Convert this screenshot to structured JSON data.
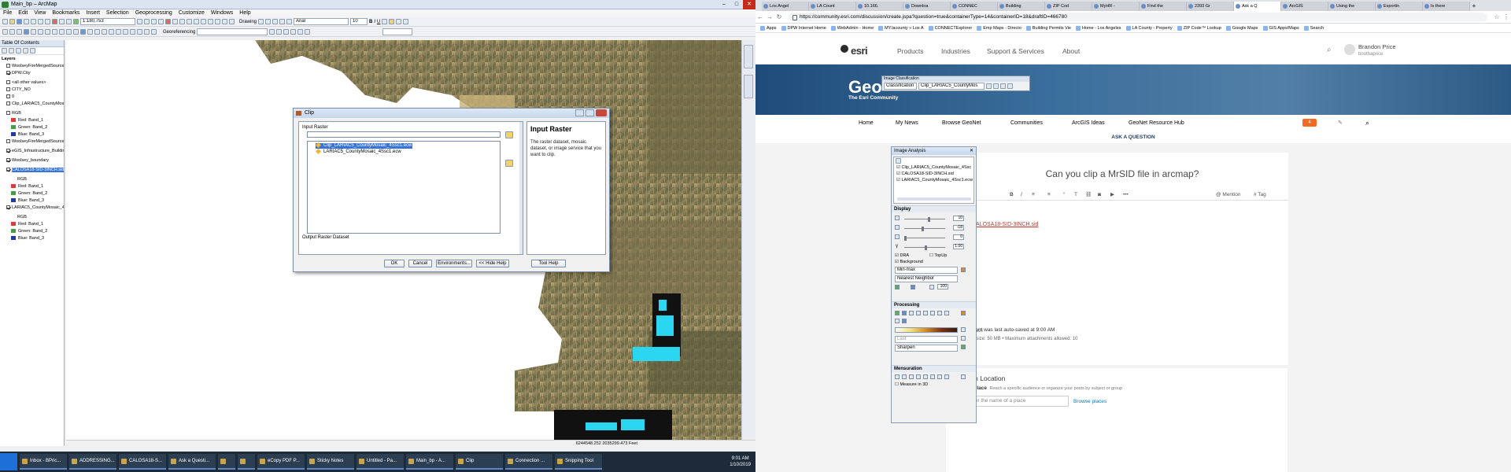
{
  "arcmap": {
    "title": "Main_bp – ArcMap",
    "menu": [
      "File",
      "Edit",
      "View",
      "Bookmarks",
      "Insert",
      "Selection",
      "Geoprocessing",
      "Customize",
      "Windows",
      "Help"
    ],
    "scale": "1:180,753",
    "drawing_label": "Drawing",
    "font_name": "Arial",
    "font_size": "10",
    "georef_label": "Georeferencing",
    "toc_title": "Table Of Contents",
    "toc": {
      "layers_label": "Layers",
      "items": [
        {
          "label": "WoolseyFireMergedSources_h",
          "checked": false,
          "indent": 0
        },
        {
          "label": "DPW.City",
          "checked": true,
          "indent": 0
        },
        {
          "label": "<all other values>",
          "checked": false,
          "indent": 2
        },
        {
          "label": "CITY_NO",
          "checked": false,
          "indent": 2
        },
        {
          "label": "0",
          "checked": false,
          "indent": 2
        },
        {
          "label": "Clip_LARIAC5_CountyMosaic_",
          "checked": false,
          "indent": 0
        },
        {
          "label": "RGB",
          "checked": false,
          "indent": 2
        },
        {
          "label": "Red:   Band_1",
          "swatch": "#e53935",
          "indent": 1
        },
        {
          "label": "Green: Band_2",
          "swatch": "#43a047",
          "indent": 1
        },
        {
          "label": "Blue:  Band_3",
          "swatch": "#1e3aa8",
          "indent": 1
        },
        {
          "label": "WoolseyFireMergedSources_h",
          "checked": false,
          "indent": 0
        },
        {
          "label": "eGIS_Infrastructure_Building_F",
          "checked": true,
          "indent": 0
        },
        {
          "label": "Woolsey_boundary",
          "checked": true,
          "indent": 0
        },
        {
          "label": "CALOSA18-SID-3INCH.sid",
          "checked": true,
          "indent": 0,
          "selected": true
        },
        {
          "label": "RGB",
          "indent": 2
        },
        {
          "label": "Red:   Band_1",
          "swatch": "#e53935",
          "indent": 1
        },
        {
          "label": "Green: Band_2",
          "swatch": "#43a047",
          "indent": 1
        },
        {
          "label": "Blue:  Band_3",
          "swatch": "#1e3aa8",
          "indent": 1
        },
        {
          "label": "LARIAC5_CountyMosaic_4Ssc",
          "checked": true,
          "indent": 0
        },
        {
          "label": "RGB",
          "indent": 2
        },
        {
          "label": "Red:   Band_1",
          "swatch": "#e53935",
          "indent": 1
        },
        {
          "label": "Green: Band_2",
          "swatch": "#43a047",
          "indent": 1
        },
        {
          "label": "Blue:  Band_3",
          "swatch": "#1e3aa8",
          "indent": 1
        }
      ]
    },
    "coords": "6244548.252  2035299.473 Feet",
    "clip_dialog": {
      "title": "Clip",
      "input_raster_label": "Input Raster",
      "list_items": [
        "Clip_LARIAC5_CountyMosaic_4Ssc1.ecw",
        "LARIAC5_CountyMosaic_4Ssc1.ecw"
      ],
      "output_label": "Output Raster Dataset",
      "help_title": "Input Raster",
      "help_text": "The raster dataset, mosaic dataset, or image service that you want to clip.",
      "buttons": {
        "ok": "OK",
        "cancel": "Cancel",
        "environments": "Environments...",
        "hide_help": "<< Hide Help",
        "tool_help": "Tool Help"
      }
    },
    "taskbar": [
      "Inbox - BPric...",
      "ADDRESSING...",
      "CALOSA18-S...",
      "Ask a Questi...",
      "",
      "",
      "eCopy PDF P...",
      "Sticky Notes",
      "Untitled - Pa...",
      "Main_bp - A...",
      "Clip",
      "Connection ...",
      "Snipping Tool"
    ],
    "clock": {
      "time": "9:01 AM",
      "date": "1/10/2019"
    }
  },
  "chrome": {
    "tabs": [
      "Los Angel",
      "LA Count",
      "10.166.",
      "Downloa",
      "CONNEC",
      "Building",
      "ZIP Cod",
      "MyHR -",
      "Find the",
      "2393 Gr",
      "Ask a Q",
      "ArcGIS",
      "Using the",
      "Exportin",
      "Is there"
    ],
    "active_tab": 10,
    "url": "https://community.esri.com/discussion/create.jspa?question=true&containerType=14&containerID=18&draftID=466780",
    "bookmarks": [
      "Apps",
      "DPW Internet Home",
      "WebAdmin - Home",
      "MY.lacounty » Los A",
      "CONNECTExplorer",
      "Emp Maps - Directo",
      "Building Permits Vie",
      "Home - Los Angeles",
      "LA County - Property",
      "ZIP Code™ Lookup",
      "Google Maps",
      "GIS Apps/Maps",
      "Search"
    ],
    "logo": "esri",
    "nav": [
      "Products",
      "Industries",
      "Support & Services",
      "About"
    ],
    "user": {
      "name": "Brandon Price",
      "handle": "bnothaprice"
    },
    "hero": {
      "title": "Geo",
      "subtitle": "The Esri Community"
    },
    "image_classification": {
      "title": "Image Classification",
      "dropdown": "Classification",
      "layer": "Clip_LARIAC5_CountyMos"
    },
    "subnav": [
      "Home",
      "My News",
      "Browse GeoNet",
      "Communities",
      "ArcGIS Ideas",
      "GeoNet Resource Hub"
    ],
    "badge": "4",
    "ask_label": "ASK A QUESTION",
    "question_title": "Can you clip a MrSID file in arcmap?",
    "editor_tools": {
      "mention": "@ Mention",
      "tag": "# Tag"
    },
    "body_link": "CALOSA18-SID-3INCH.sid",
    "autosave": "content was last auto-saved at 9:00 AM",
    "attach": {
      "label": "ach",
      "limits": "num size: 50 MB  •  Maximum attachments allowed: 10"
    },
    "publish": {
      "title": "Publish Location",
      "option": "In a Place",
      "option_desc": "Reach a specific audience or organize your posts by subject or group",
      "placeholder": "Enter the name of a place",
      "browse": "Browse places"
    }
  },
  "image_analysis": {
    "title": "Image Analysis",
    "layers": [
      "Clip_LARIAC5_CountyMosaic_4Ssc",
      "CALOSA18-SID-3INCH.sid",
      "LARIAC5_CountyMosaic_4Ssc1.ecw"
    ],
    "display_label": "Display",
    "values": [
      "10",
      "-18",
      "0",
      "1.00"
    ],
    "dra_label": "DRA",
    "transp_label": "TopUp",
    "background_label": "Background",
    "stretch": "Min-max",
    "resample": "Nearest Neighbor",
    "zoom": "100",
    "processing_label": "Processing",
    "last_label": "Last",
    "sharpen": "Sharpen",
    "measure_label": "Mensuration",
    "measure3d": "Measure in 3D"
  },
  "colors": {
    "selection": "#3874d8",
    "esri_blue": "#0079c1",
    "hero": "#2c5a86"
  }
}
